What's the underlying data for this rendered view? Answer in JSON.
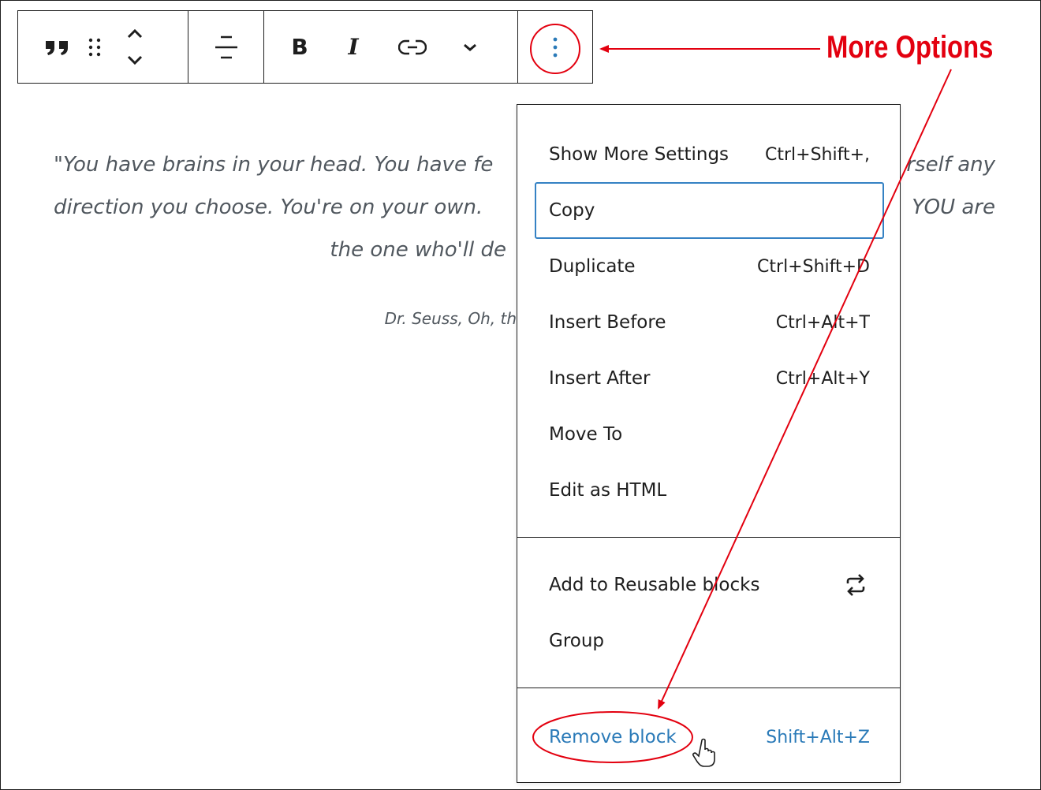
{
  "toolbar": {
    "buttons": [
      {
        "name": "quote-block-icon"
      },
      {
        "name": "drag-handle-icon"
      },
      {
        "name": "move-up-down-icon"
      },
      {
        "name": "align-center-icon"
      },
      {
        "name": "bold-button",
        "label": "B"
      },
      {
        "name": "italic-button",
        "label": "I"
      },
      {
        "name": "link-icon"
      },
      {
        "name": "chevron-down-icon"
      },
      {
        "name": "more-options-icon"
      }
    ]
  },
  "quote": {
    "line1_left": "\"You have brains in your head. You have fe",
    "line1_right": "rself any",
    "line2_left": "direction you choose. You're on your own.",
    "line2_right": "YOU are",
    "line3_left": "the one who'll de",
    "citation_left": "Dr. Seuss, Oh, th"
  },
  "menu": {
    "items": [
      {
        "label": "Show More Settings",
        "shortcut": "Ctrl+Shift+,"
      },
      {
        "label": "Copy",
        "shortcut": ""
      },
      {
        "label": "Duplicate",
        "shortcut": "Ctrl+Shift+D"
      },
      {
        "label": "Insert Before",
        "shortcut": "Ctrl+Alt+T"
      },
      {
        "label": "Insert After",
        "shortcut": "Ctrl+Alt+Y"
      },
      {
        "label": "Move To",
        "shortcut": ""
      },
      {
        "label": "Edit as HTML",
        "shortcut": ""
      }
    ],
    "reusable": {
      "label": "Add to Reusable blocks",
      "icon": "reusable-block-icon"
    },
    "group": {
      "label": "Group"
    },
    "remove": {
      "label": "Remove block",
      "shortcut": "Shift+Alt+Z"
    }
  },
  "annotation": {
    "label": "More Options",
    "color": "#e3000f"
  },
  "colors": {
    "accent": "#3582c4",
    "danger_text": "#2a7ab8",
    "quote_text": "#50575e"
  }
}
